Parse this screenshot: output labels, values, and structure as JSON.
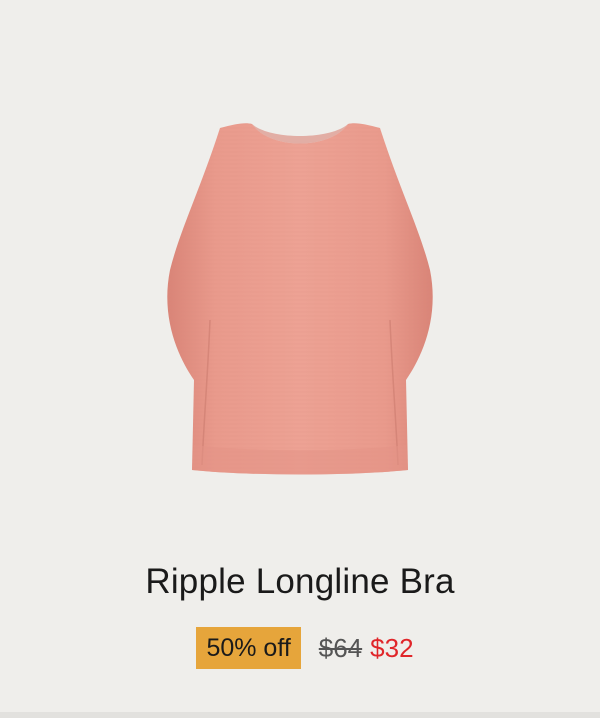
{
  "product": {
    "name": "Ripple Longline Bra",
    "image_icon": "bra-product-image",
    "color_hex": "#e99a8c"
  },
  "pricing": {
    "discount_badge": "50% off",
    "original_price": "$64",
    "sale_price": "$32"
  },
  "colors": {
    "background": "#efeeeb",
    "badge": "#e6a53b",
    "sale_price": "#e0262a"
  }
}
